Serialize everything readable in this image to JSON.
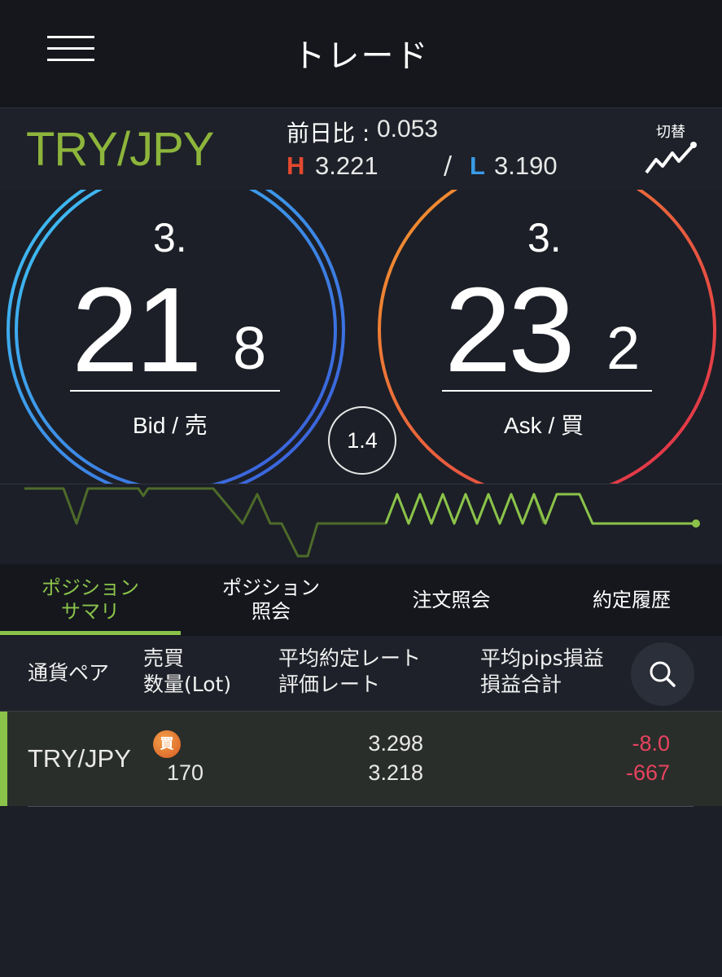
{
  "header": {
    "title": "トレード"
  },
  "pair_bar": {
    "pair": "TRY/JPY",
    "prev_day_label": "前日比 :",
    "prev_day_value": "0.053",
    "high_letter": "H",
    "high_value": "3.221",
    "separator": "/",
    "low_letter": "L",
    "low_value": "3.190",
    "switch_label": "切替"
  },
  "rates": {
    "bid": {
      "prefix": "3.",
      "main": "21",
      "fraction": "8",
      "label": "Bid / 売"
    },
    "ask": {
      "prefix": "3.",
      "main": "23",
      "fraction": "2",
      "label": "Ask / 買"
    },
    "spread": "1.4"
  },
  "tabs": [
    {
      "label": "ポジション\nサマリ",
      "active": true
    },
    {
      "label": "ポジション\n照会",
      "active": false
    },
    {
      "label": "注文照会",
      "active": false
    },
    {
      "label": "約定履歴",
      "active": false
    }
  ],
  "table": {
    "headers": {
      "pair": "通貨ペア",
      "side_qty": "売買\n数量(Lot)",
      "avg_eval": "平均約定レート\n評価レート",
      "pips_pl": "平均pips損益\n損益合計"
    },
    "rows": [
      {
        "pair": "TRY/JPY",
        "side": "買",
        "qty": "170",
        "avg_rate": "3.298",
        "eval_rate": "3.218",
        "avg_pips": "-8.0",
        "total_pl": "-667"
      }
    ]
  },
  "colors": {
    "pair_green": "#8db53c",
    "high_red": "#e3492f",
    "low_blue": "#3a9be6",
    "loss_red": "#e8435f",
    "active_tab": "#8bc34a"
  }
}
